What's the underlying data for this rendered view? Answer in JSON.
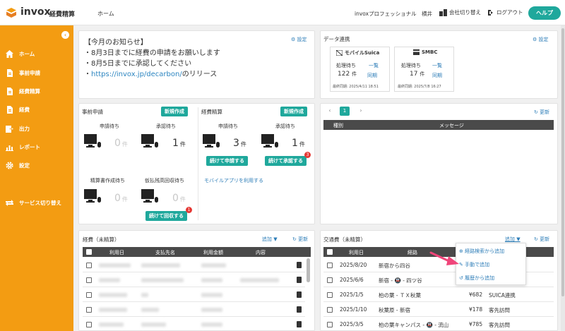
{
  "header": {
    "logo_text": "invox",
    "logo_sub": "経費精算",
    "nav_home": "ホーム",
    "user": "invoxプロフェッショナル　横井",
    "switch_company": "会社切り替え",
    "logout": "ログアウト",
    "help": "ヘルプ"
  },
  "sidebar": {
    "items": [
      {
        "label": "ホーム",
        "icon": "home-icon"
      },
      {
        "label": "事前申請",
        "icon": "document-icon"
      },
      {
        "label": "経費精算",
        "icon": "document-icon"
      },
      {
        "label": "経費",
        "icon": "document-icon"
      },
      {
        "label": "出力",
        "icon": "export-icon"
      },
      {
        "label": "レポート",
        "icon": "chart-icon"
      },
      {
        "label": "設定",
        "icon": "gear-icon"
      },
      {
        "label": "サービス切り替え",
        "icon": "switch-icon"
      }
    ]
  },
  "notice": {
    "settings": "設定",
    "lines": [
      "【今月のお知らせ】",
      "・8月3日までに経費の申請をお願いします",
      "・8月5日までに承認してください"
    ],
    "link_prefix": "・",
    "link": "https://invox.jp/decarbon/",
    "link_suffix": "のリリース"
  },
  "data_link": {
    "title": "データ連携",
    "settings": "設定",
    "cards": [
      {
        "name": "モバイルSuica",
        "pending_label": "処理待ち",
        "list": "一覧",
        "count": "122",
        "unit": "件",
        "sync": "同期",
        "last_sync": "最終同期: 2025/4/11 18:51"
      },
      {
        "name": "SMBC",
        "pending_label": "処理待ち",
        "list": "一覧",
        "count": "17",
        "unit": "件",
        "sync": "同期",
        "last_sync": "最終同期: 2025/7/8 16:27"
      }
    ]
  },
  "pre_application": {
    "title": "事前申請",
    "new": "新規作成",
    "pending_label": "申請待ち",
    "pending_count": "0",
    "approve_label": "承認待ち",
    "approve_count": "1",
    "doc_label": "精算書作成待ち",
    "doc_count": "0",
    "advance_label": "仮払残高回収待ち",
    "advance_count": "0",
    "collect_btn": "続けて回収する",
    "collect_badge": "1",
    "unit": "件"
  },
  "settlement": {
    "title": "経費精算",
    "new": "新規作成",
    "pending_label": "申請待ち",
    "pending_count": "3",
    "approve_label": "承認待ち",
    "approve_count": "1",
    "apply_btn": "続けて申請する",
    "approve_btn": "続けて承認する",
    "approve_badge": "3",
    "mobile_link": "モバイルアプリを利用する",
    "unit": "件"
  },
  "messages": {
    "refresh": "更新",
    "page": "1",
    "col_type": "種別",
    "col_message": "メッセージ"
  },
  "expenses": {
    "title": "経費（未精算）",
    "add": "追加",
    "refresh": "更新",
    "columns": [
      "利用日",
      "支払先名",
      "利用金額",
      "内容"
    ]
  },
  "transport": {
    "title": "交通費（未精算）",
    "add": "追加",
    "refresh": "更新",
    "columns": [
      "利用日",
      "経路"
    ],
    "rows": [
      {
        "date": "2025/8/20",
        "route": "新宿から四谷",
        "amount": "",
        "memo": ""
      },
      {
        "date": "2025/6/6",
        "route": "新宿 - 🚇 - 四ツ谷",
        "amount": "",
        "memo": ""
      },
      {
        "date": "2025/1/5",
        "route": "柏の葉 - ＴＸ秋葉",
        "amount": "¥682",
        "memo": "SUICA連携"
      },
      {
        "date": "2025/1/10",
        "route": "秋葉原 - 新宿",
        "amount": "¥178",
        "memo": "客先訪問"
      },
      {
        "date": "2025/3/5",
        "route": "柏の葉キャンパス - 🚇 - 流山",
        "amount": "¥785",
        "memo": "客先訪問"
      }
    ],
    "dropdown": [
      "経路検索から追加",
      "手動で追加",
      "履歴から追加"
    ]
  },
  "colors": {
    "accent": "#f39c12",
    "green": "#1fa89c",
    "link": "#2e7eb8",
    "arrow": "#f0457a"
  }
}
